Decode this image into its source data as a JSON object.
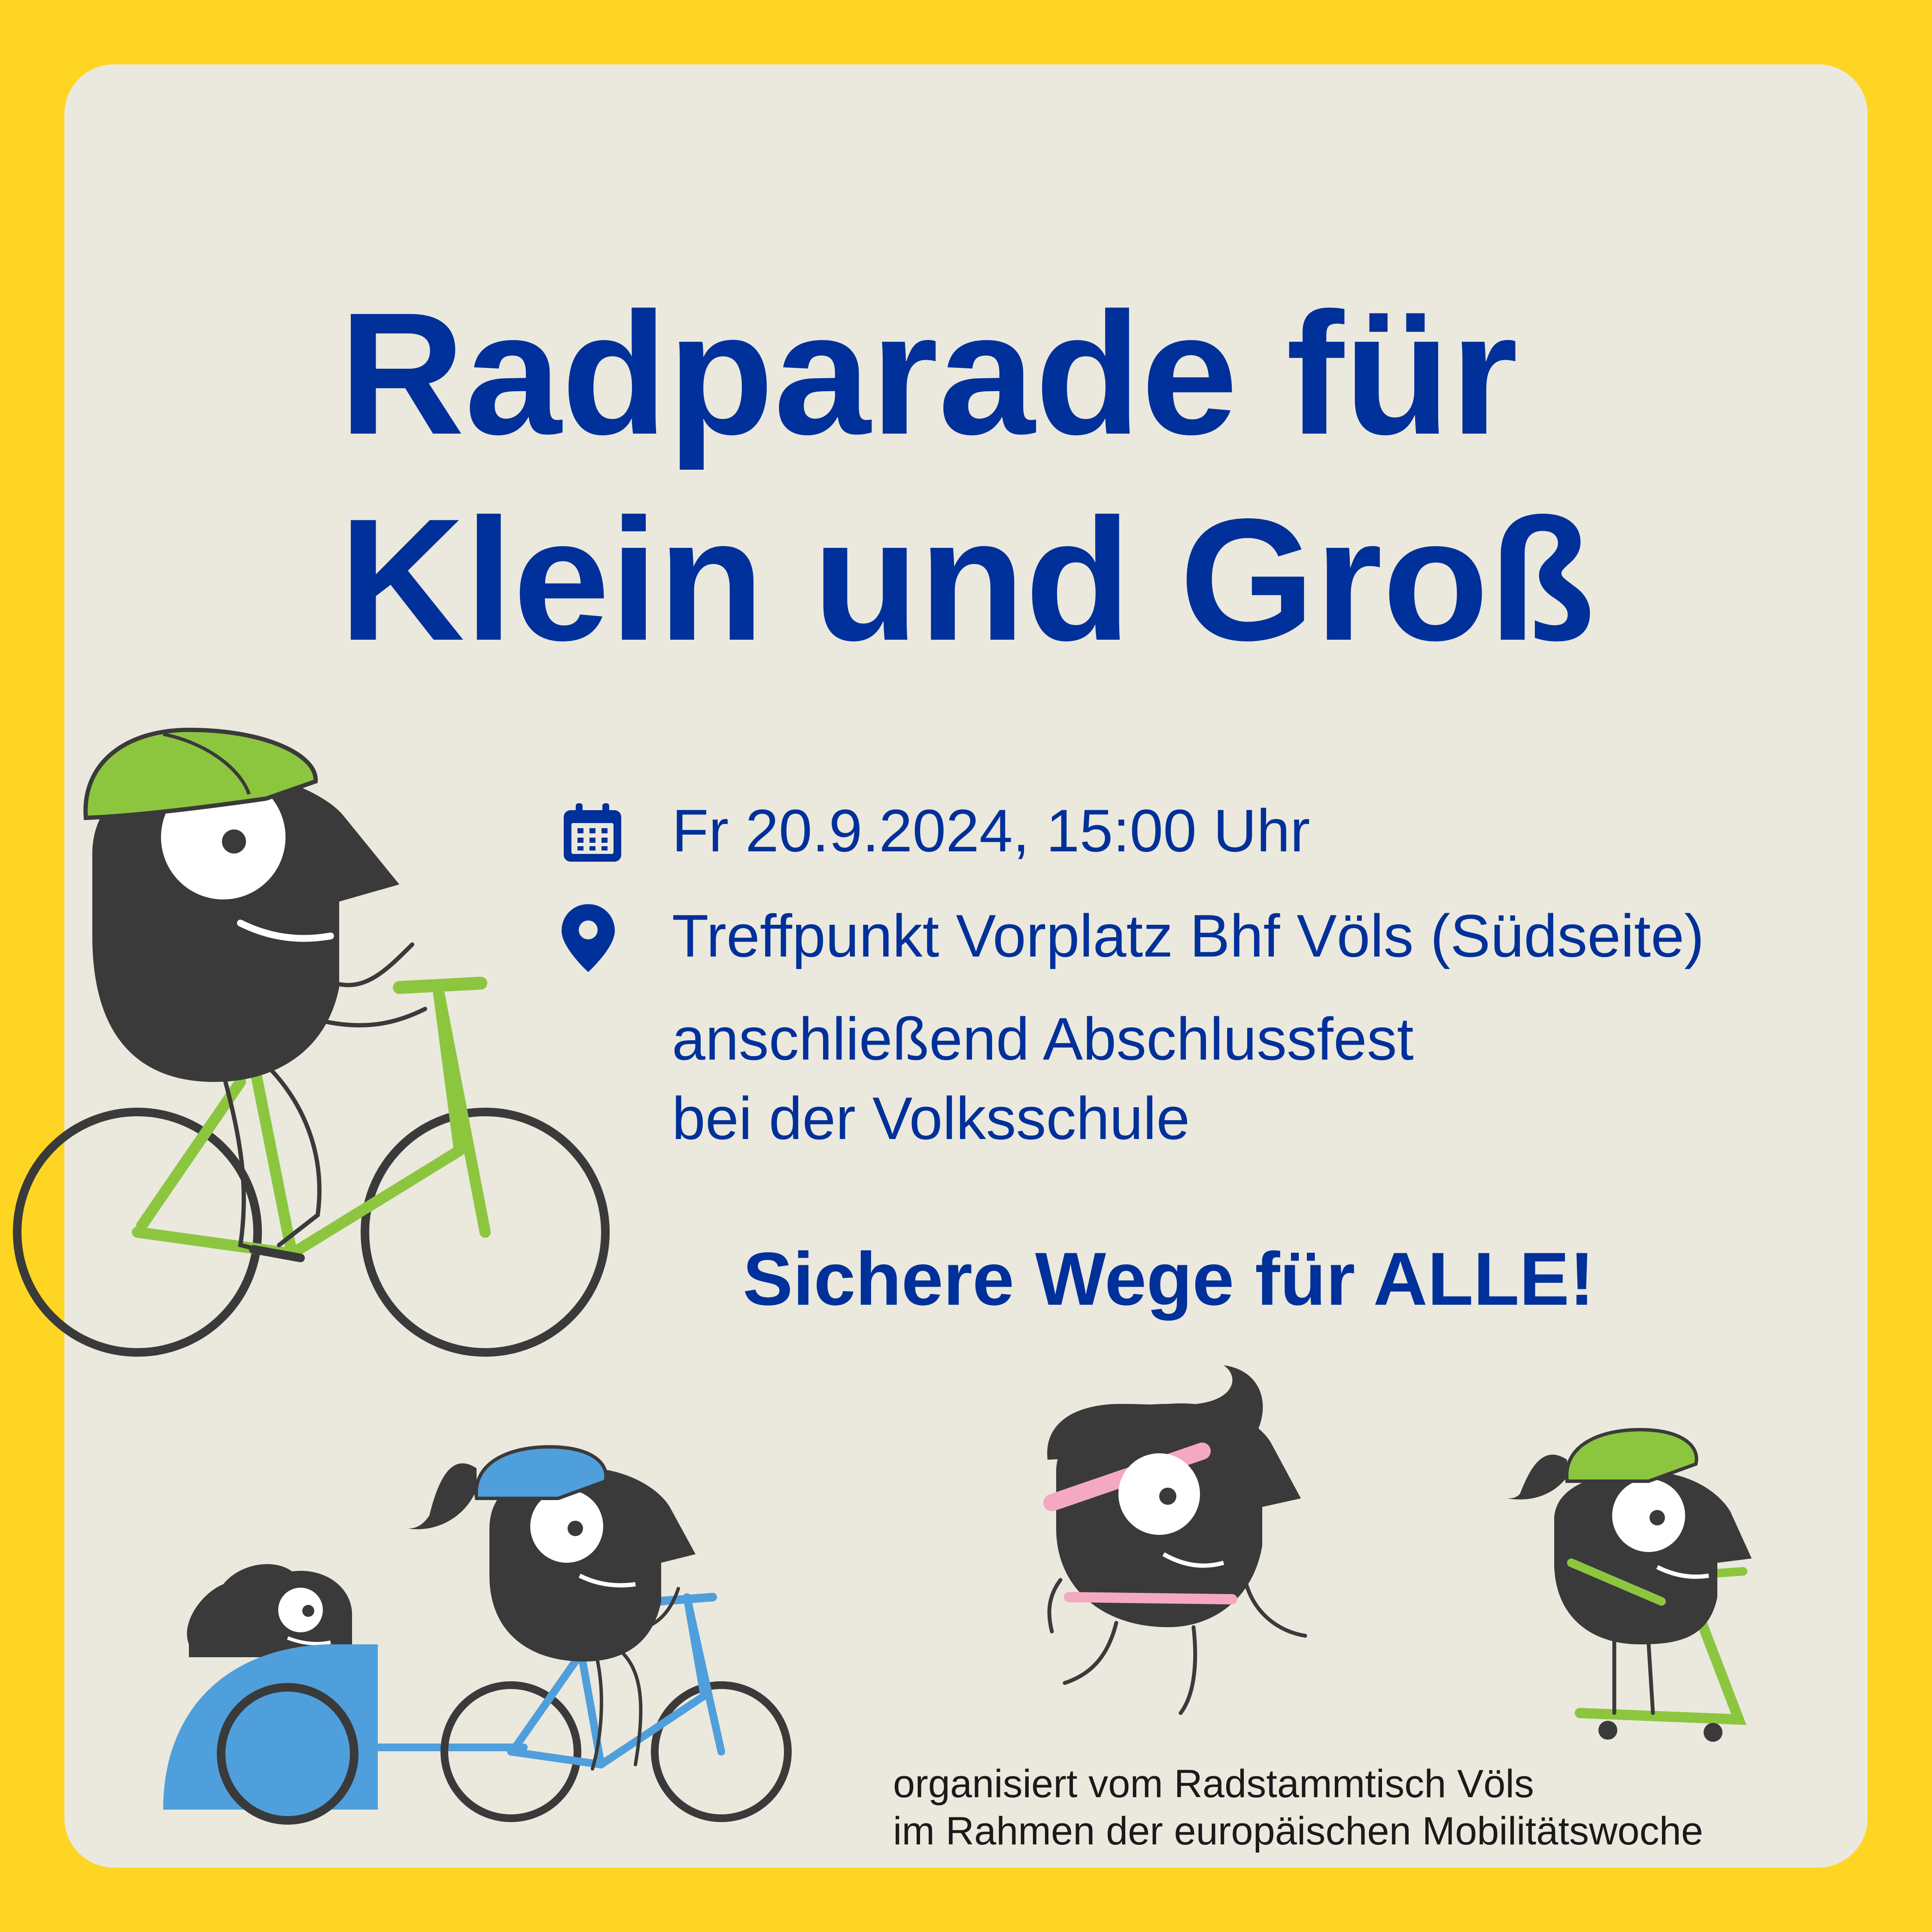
{
  "colors": {
    "frame": "#ffd524",
    "card": "#ebe8de",
    "text_primary": "#00309a",
    "character": "#3a3a3a",
    "green": "#8cc63f",
    "blue": "#4f9fdc",
    "pink": "#f4a9c0"
  },
  "title": {
    "line1": "Radparade für",
    "line2": "Klein und Groß"
  },
  "event": {
    "date_icon": "calendar-icon",
    "date": "Fr 20.9.2024, 15:00 Uhr",
    "location_icon": "location-pin-icon",
    "location": "Treffpunkt Vorplatz Bhf Völs (Südseite)",
    "after_line1": "anschließend Abschlussfest",
    "after_line2": "bei der Volksschule"
  },
  "slogan": "Sichere Wege für ALLE!",
  "footer": {
    "line1": "organisiert vom Radstammtisch Völs",
    "line2": "im Rahmen der europäischen Mobilitätswoche"
  }
}
